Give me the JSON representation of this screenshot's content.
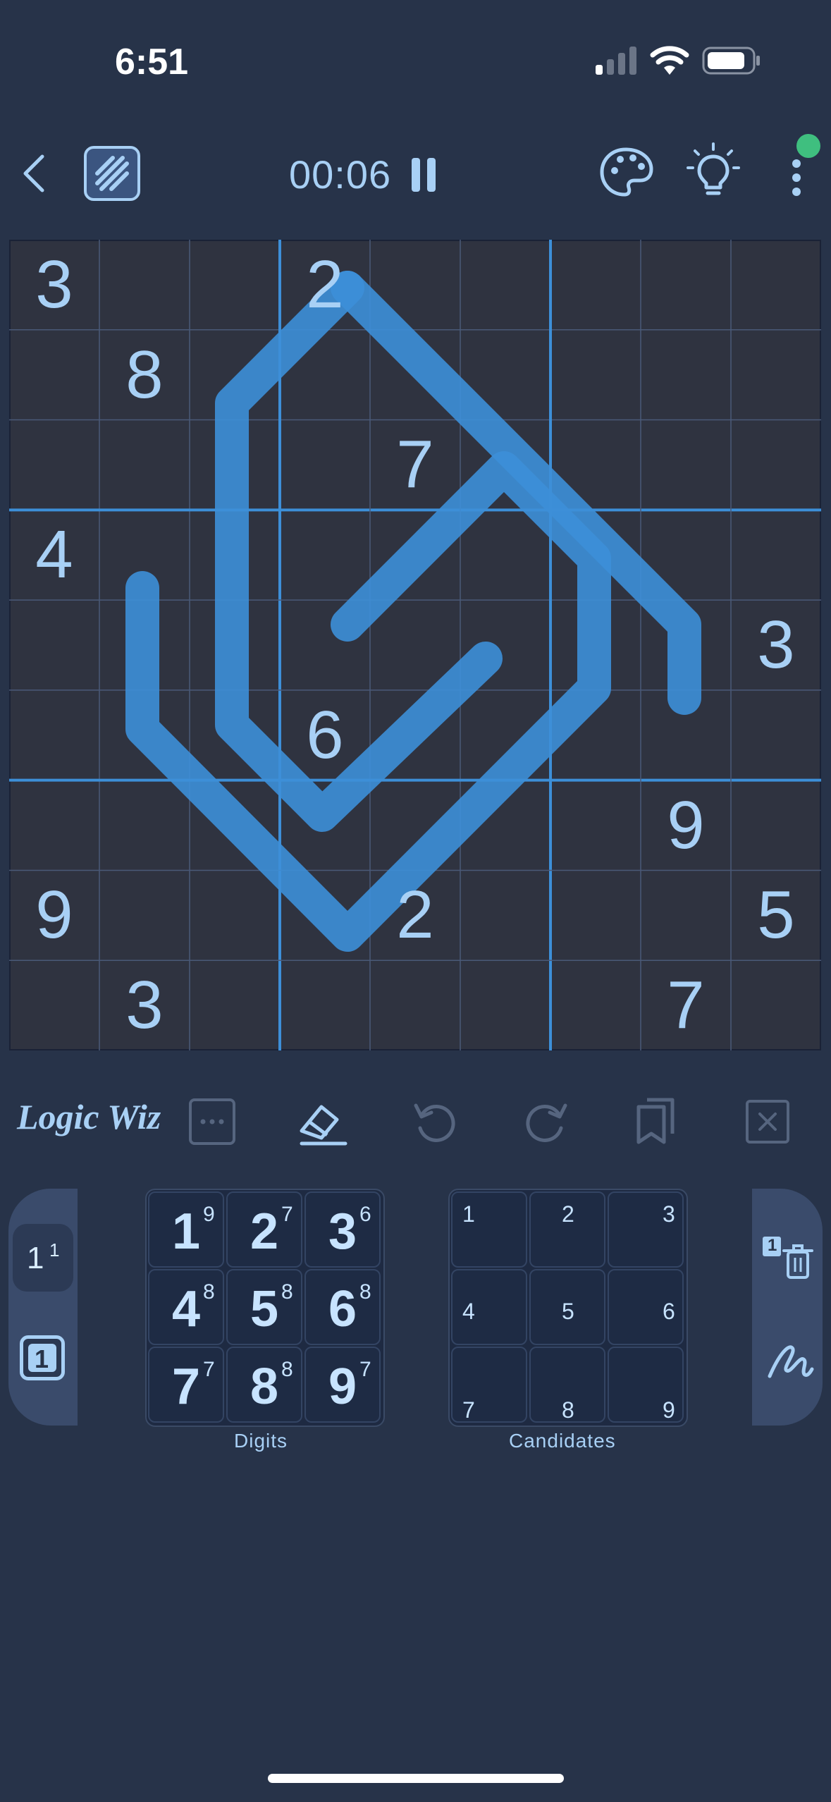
{
  "status": {
    "time": "6:51"
  },
  "header": {
    "timer": "00:06",
    "back_icon": "chevron-left-icon",
    "mode_icon": "striped-square-icon",
    "pause_icon": "pause-icon",
    "theme_icon": "palette-icon",
    "hint_icon": "lightbulb-icon",
    "menu_icon": "more-vertical-icon",
    "notification_color": "#3fbf7f"
  },
  "board": {
    "size": 9,
    "givens": [
      {
        "row": 0,
        "col": 0,
        "value": "3"
      },
      {
        "row": 0,
        "col": 3,
        "value": "2"
      },
      {
        "row": 1,
        "col": 1,
        "value": "8"
      },
      {
        "row": 2,
        "col": 4,
        "value": "7"
      },
      {
        "row": 3,
        "col": 0,
        "value": "4"
      },
      {
        "row": 4,
        "col": 8,
        "value": "3"
      },
      {
        "row": 5,
        "col": 3,
        "value": "6"
      },
      {
        "row": 6,
        "col": 7,
        "value": "9"
      },
      {
        "row": 7,
        "col": 0,
        "value": "9"
      },
      {
        "row": 7,
        "col": 4,
        "value": "2"
      },
      {
        "row": 7,
        "col": 8,
        "value": "5"
      },
      {
        "row": 8,
        "col": 1,
        "value": "3"
      },
      {
        "row": 8,
        "col": 7,
        "value": "7"
      }
    ],
    "line_color": "#3d8fd8",
    "cell_color": "#2f3340"
  },
  "toolbar": {
    "logo": "Logic Wiz",
    "tools": [
      "more-horizontal-icon",
      "eraser-icon",
      "undo-icon",
      "redo-icon",
      "copy-icon",
      "clear-icon"
    ]
  },
  "modes_left": {
    "candidate_mode": "1",
    "candidate_sup": "1",
    "digit_mode": "1"
  },
  "digits": {
    "label": "Digits",
    "keys": [
      {
        "digit": "1",
        "count": "9"
      },
      {
        "digit": "2",
        "count": "7"
      },
      {
        "digit": "3",
        "count": "6"
      },
      {
        "digit": "4",
        "count": "8"
      },
      {
        "digit": "5",
        "count": "8"
      },
      {
        "digit": "6",
        "count": "8"
      },
      {
        "digit": "7",
        "count": "7"
      },
      {
        "digit": "8",
        "count": "8"
      },
      {
        "digit": "9",
        "count": "7"
      }
    ]
  },
  "candidates": {
    "label": "Candidates",
    "keys": [
      "1",
      "2",
      "3",
      "4",
      "5",
      "6",
      "7",
      "8",
      "9"
    ]
  },
  "modes_right": {
    "delete_digit": "1"
  }
}
